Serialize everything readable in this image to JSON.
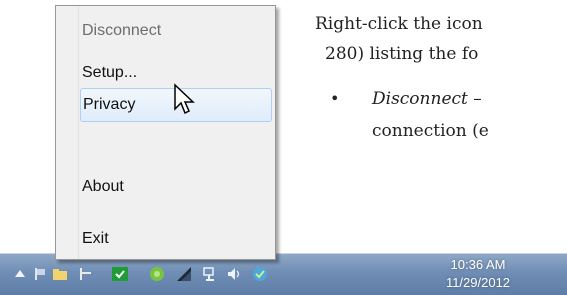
{
  "doc": {
    "line1": "Right-click the icon",
    "line2": "280) listing the fo",
    "bullet_symbol": "•",
    "bullet_term": "Disconnect",
    "bullet_rest": " – ",
    "line4": "connection (e"
  },
  "menu": {
    "items": [
      {
        "label": "Disconnect",
        "state": "disabled"
      },
      {
        "label": "Setup...",
        "state": "normal"
      },
      {
        "label": "Privacy",
        "state": "hover"
      },
      {
        "label": "About",
        "state": "normal"
      },
      {
        "label": "Exit",
        "state": "normal"
      }
    ]
  },
  "taskbar": {
    "tray_icons": [
      "show-hidden-icons-arrow-icon",
      "flag-icon",
      "folder-icon",
      "pin-icon",
      "green-check-icon",
      "green-app-icon",
      "signal-icon",
      "network-icon",
      "volume-icon",
      "security-shield-icon"
    ],
    "clock_time": "10:36 AM",
    "clock_date": "11/29/2012"
  },
  "colors": {
    "menu_bg": "#f0f0f0",
    "menu_hover": "#dfecfa",
    "taskbar": "#6f8db5"
  }
}
